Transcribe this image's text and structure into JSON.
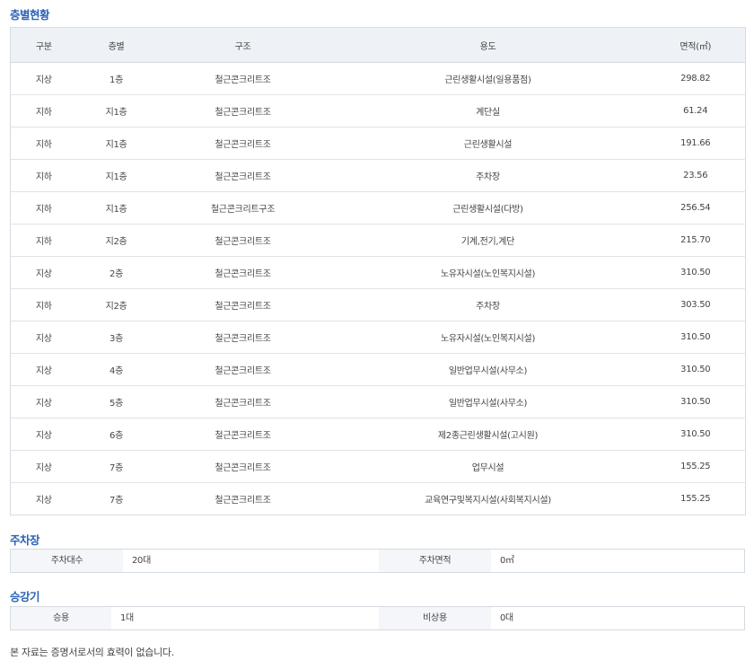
{
  "floors": {
    "title": "층별현황",
    "headers": {
      "category": "구분",
      "floor": "층별",
      "structure": "구조",
      "usage": "용도",
      "area": "면적(㎡)"
    },
    "rows": [
      {
        "category": "지상",
        "floor": "1층",
        "structure": "철근콘크리트조",
        "usage": "근린생활시설(일용품점)",
        "area": "298.82"
      },
      {
        "category": "지하",
        "floor": "지1층",
        "structure": "철근콘크리트조",
        "usage": "계단실",
        "area": "61.24"
      },
      {
        "category": "지하",
        "floor": "지1층",
        "structure": "철근콘크리트조",
        "usage": "근린생활시설",
        "area": "191.66"
      },
      {
        "category": "지하",
        "floor": "지1층",
        "structure": "철근콘크리트조",
        "usage": "주차장",
        "area": "23.56"
      },
      {
        "category": "지하",
        "floor": "지1층",
        "structure": "철근콘크리트구조",
        "usage": "근린생활시설(다방)",
        "area": "256.54"
      },
      {
        "category": "지하",
        "floor": "지2층",
        "structure": "철근콘크리트조",
        "usage": "기계,전기,계단",
        "area": "215.70"
      },
      {
        "category": "지상",
        "floor": "2층",
        "structure": "철근콘크리트조",
        "usage": "노유자시설(노인복지시설)",
        "area": "310.50"
      },
      {
        "category": "지하",
        "floor": "지2층",
        "structure": "철근콘크리트조",
        "usage": "주차장",
        "area": "303.50"
      },
      {
        "category": "지상",
        "floor": "3층",
        "structure": "철근콘크리트조",
        "usage": "노유자시설(노인복지시설)",
        "area": "310.50"
      },
      {
        "category": "지상",
        "floor": "4층",
        "structure": "철근콘크리트조",
        "usage": "일반업무시설(사무소)",
        "area": "310.50"
      },
      {
        "category": "지상",
        "floor": "5층",
        "structure": "철근콘크리트조",
        "usage": "일반업무시설(사무소)",
        "area": "310.50"
      },
      {
        "category": "지상",
        "floor": "6층",
        "structure": "철근콘크리트조",
        "usage": "제2종근린생활시설(고시원)",
        "area": "310.50"
      },
      {
        "category": "지상",
        "floor": "7층",
        "structure": "철근콘크리트조",
        "usage": "업무시설",
        "area": "155.25"
      },
      {
        "category": "지상",
        "floor": "7층",
        "structure": "철근콘크리트조",
        "usage": "교육연구및복지시설(사회복지시설)",
        "area": "155.25"
      }
    ]
  },
  "parking": {
    "title": "주차장",
    "count_label": "주차대수",
    "count_value": "20대",
    "area_label": "주차면적",
    "area_value": "0㎡"
  },
  "elevator": {
    "title": "승강기",
    "passenger_label": "승용",
    "passenger_value": "1대",
    "emergency_label": "비상용",
    "emergency_value": "0대"
  },
  "footer_note": "본 자료는 증명서로서의 효력이 없습니다."
}
